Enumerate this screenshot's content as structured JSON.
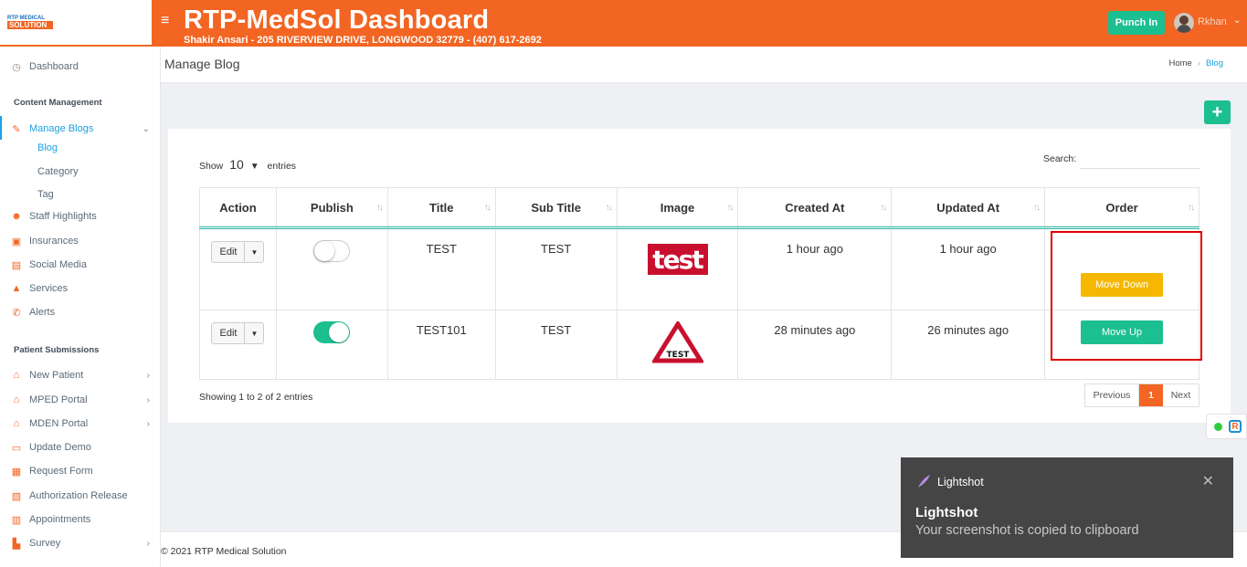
{
  "brand": {
    "logo_line1": "RTP MEDICAL",
    "logo_line2": "SOLUTION"
  },
  "header": {
    "title": "RTP-MedSol Dashboard",
    "subtitle": "Shakir Ansari - 205 RIVERVIEW DRIVE, LONGWOOD 32779 - (407) 617-2692",
    "punch_label": "Punch In",
    "user_name": "Rkhan"
  },
  "sidebar": {
    "dashboard": "Dashboard",
    "section_content": "Content Management",
    "manage_blogs": "Manage Blogs",
    "blog_sub": [
      "Blog",
      "Category",
      "Tag"
    ],
    "content_items": [
      "Staff Highlights",
      "Insurances",
      "Social Media",
      "Services",
      "Alerts"
    ],
    "section_patient": "Patient Submissions",
    "patient_items": [
      "New Patient",
      "MPED Portal",
      "MDEN Portal",
      "Update Demo",
      "Request Form",
      "Authorization Release",
      "Appointments",
      "Survey"
    ]
  },
  "page": {
    "title": "Manage Blog",
    "breadcrumb_home": "Home",
    "breadcrumb_current": "Blog",
    "add_label": "+"
  },
  "table": {
    "show_label": "Show",
    "entries_value": "10",
    "entries_label": "entries",
    "search_label": "Search:",
    "columns": [
      "Action",
      "Publish",
      "Title",
      "Sub Title",
      "Image",
      "Created At",
      "Updated At",
      "Order"
    ],
    "rows": [
      {
        "action": "Edit",
        "published": false,
        "title": "TEST",
        "subtitle": "TEST",
        "image_text": "test",
        "created": "1 hour ago",
        "updated": "1 hour ago",
        "order_btn": "Move Down"
      },
      {
        "action": "Edit",
        "published": true,
        "title": "TEST101",
        "subtitle": "TEST",
        "image_text": "TEST",
        "created": "28 minutes ago",
        "updated": "26 minutes ago",
        "order_btn": "Move Up"
      }
    ],
    "info": "Showing 1 to 2 of 2 entries",
    "pager": {
      "prev": "Previous",
      "page": "1",
      "next": "Next"
    }
  },
  "footer": {
    "text": "© 2021 RTP Medical Solution"
  },
  "toast": {
    "app": "Lightshot",
    "title": "Lightshot",
    "message": "Your screenshot is copied to clipboard"
  },
  "colors": {
    "brand_orange": "#f26522",
    "success_green": "#1cbf8f",
    "warning_yellow": "#f5b700",
    "link_blue": "#1ba1e2",
    "highlight_red": "#e00000"
  }
}
